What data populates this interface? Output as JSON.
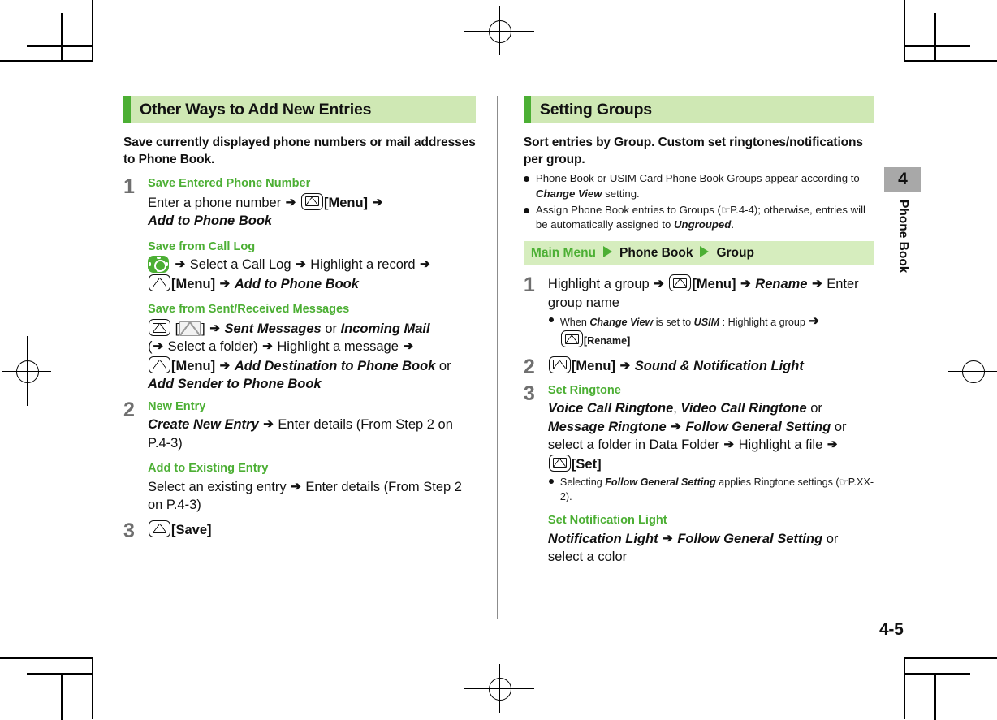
{
  "page": {
    "number": "4-5",
    "chapter_number": "4",
    "chapter_label": "Phone Book"
  },
  "left_column": {
    "section_title": "Other Ways to Add New Entries",
    "lead": "Save currently displayed phone numbers or mail addresses to Phone Book.",
    "steps": [
      {
        "number": "1",
        "sub_sections": [
          {
            "heading": "Save Entered Phone Number",
            "lines": [
              {
                "parts": [
                  {
                    "t": "text",
                    "v": "Enter a phone number "
                  },
                  {
                    "t": "arrow"
                  },
                  {
                    "t": "text",
                    "v": " "
                  },
                  {
                    "t": "key-env"
                  },
                  {
                    "t": "bold",
                    "v": "[Menu]"
                  },
                  {
                    "t": "text",
                    "v": " "
                  },
                  {
                    "t": "arrow"
                  }
                ]
              },
              {
                "parts": [
                  {
                    "t": "bolditalic",
                    "v": "Add to Phone Book"
                  }
                ]
              }
            ]
          },
          {
            "heading": "Save from Call Log",
            "lines": [
              {
                "parts": [
                  {
                    "t": "key-nav"
                  },
                  {
                    "t": "text",
                    "v": " "
                  },
                  {
                    "t": "arrow"
                  },
                  {
                    "t": "text",
                    "v": " Select a Call Log "
                  },
                  {
                    "t": "arrow"
                  },
                  {
                    "t": "text",
                    "v": " Highlight a record "
                  },
                  {
                    "t": "arrow"
                  }
                ]
              },
              {
                "parts": [
                  {
                    "t": "key-env"
                  },
                  {
                    "t": "bold",
                    "v": "[Menu]"
                  },
                  {
                    "t": "text",
                    "v": " "
                  },
                  {
                    "t": "arrow"
                  },
                  {
                    "t": "text",
                    "v": " "
                  },
                  {
                    "t": "bolditalic",
                    "v": "Add to Phone Book"
                  }
                ]
              }
            ]
          },
          {
            "heading": "Save from Sent/Received Messages",
            "lines": [
              {
                "parts": [
                  {
                    "t": "key-env"
                  },
                  {
                    "t": "text",
                    "v": " ["
                  },
                  {
                    "t": "disp-env"
                  },
                  {
                    "t": "text",
                    "v": "] "
                  },
                  {
                    "t": "arrow"
                  },
                  {
                    "t": "text",
                    "v": " "
                  },
                  {
                    "t": "bolditalic",
                    "v": "Sent Messages"
                  },
                  {
                    "t": "text",
                    "v": " or "
                  },
                  {
                    "t": "bolditalic",
                    "v": "Incoming Mail"
                  }
                ]
              },
              {
                "parts": [
                  {
                    "t": "text",
                    "v": "("
                  },
                  {
                    "t": "arrow"
                  },
                  {
                    "t": "text",
                    "v": " Select a folder) "
                  },
                  {
                    "t": "arrow"
                  },
                  {
                    "t": "text",
                    "v": " Highlight a message "
                  },
                  {
                    "t": "arrow"
                  }
                ]
              },
              {
                "parts": [
                  {
                    "t": "key-env"
                  },
                  {
                    "t": "bold",
                    "v": "[Menu]"
                  },
                  {
                    "t": "text",
                    "v": " "
                  },
                  {
                    "t": "arrow"
                  },
                  {
                    "t": "text",
                    "v": " "
                  },
                  {
                    "t": "bolditalic",
                    "v": "Add Destination to Phone Book"
                  },
                  {
                    "t": "text",
                    "v": " or"
                  }
                ]
              },
              {
                "parts": [
                  {
                    "t": "bolditalic",
                    "v": "Add Sender to Phone Book"
                  }
                ]
              }
            ]
          }
        ]
      },
      {
        "number": "2",
        "sub_sections": [
          {
            "heading": "New Entry",
            "lines": [
              {
                "parts": [
                  {
                    "t": "bolditalic",
                    "v": "Create New Entry"
                  },
                  {
                    "t": "text",
                    "v": " "
                  },
                  {
                    "t": "arrow"
                  },
                  {
                    "t": "text",
                    "v": " Enter details (From Step 2 on P.4-3)"
                  }
                ]
              }
            ]
          },
          {
            "heading": "Add to Existing Entry",
            "lines": [
              {
                "parts": [
                  {
                    "t": "text",
                    "v": "Select an existing entry "
                  },
                  {
                    "t": "arrow"
                  },
                  {
                    "t": "text",
                    "v": " Enter details (From Step 2 on P.4-3)"
                  }
                ]
              }
            ]
          }
        ]
      },
      {
        "number": "3",
        "sub_sections": [
          {
            "heading": "",
            "lines": [
              {
                "parts": [
                  {
                    "t": "key-env"
                  },
                  {
                    "t": "bold",
                    "v": "[Save]"
                  }
                ]
              }
            ]
          }
        ]
      }
    ]
  },
  "right_column": {
    "section_title": "Setting Groups",
    "lead": "Sort entries by Group. Custom set ringtones/notifications per group.",
    "bullets": [
      {
        "parts": [
          {
            "t": "text",
            "v": "Phone Book or USIM Card Phone Book Groups appear according to "
          },
          {
            "t": "bolditalic",
            "v": "Change View"
          },
          {
            "t": "text",
            "v": " setting."
          }
        ]
      },
      {
        "parts": [
          {
            "t": "text",
            "v": "Assign Phone Book entries to Groups ("
          },
          {
            "t": "ref-hand"
          },
          {
            "t": "text",
            "v": "P.4-4); otherwise, entries will be automatically assigned to "
          },
          {
            "t": "bolditalic",
            "v": "Ungrouped"
          },
          {
            "t": "text",
            "v": "."
          }
        ]
      }
    ],
    "menu_path": {
      "root": "Main Menu",
      "items": [
        "Phone Book",
        "Group"
      ]
    },
    "steps": [
      {
        "number": "1",
        "sub_sections": [
          {
            "heading": "",
            "lines": [
              {
                "parts": [
                  {
                    "t": "text",
                    "v": "Highlight a group "
                  },
                  {
                    "t": "arrow"
                  },
                  {
                    "t": "text",
                    "v": " "
                  },
                  {
                    "t": "key-env"
                  },
                  {
                    "t": "bold",
                    "v": "[Menu]"
                  },
                  {
                    "t": "text",
                    "v": " "
                  },
                  {
                    "t": "arrow"
                  },
                  {
                    "t": "text",
                    "v": " "
                  },
                  {
                    "t": "bolditalic",
                    "v": "Rename"
                  },
                  {
                    "t": "text",
                    "v": " "
                  },
                  {
                    "t": "arrow"
                  },
                  {
                    "t": "text",
                    "v": " Enter group name"
                  }
                ]
              }
            ],
            "sub_bullets": [
              {
                "parts": [
                  {
                    "t": "text",
                    "v": "When "
                  },
                  {
                    "t": "bolditalic",
                    "v": "Change View"
                  },
                  {
                    "t": "text",
                    "v": " is set to "
                  },
                  {
                    "t": "bolditalic",
                    "v": "USIM"
                  },
                  {
                    "t": "text",
                    "v": " : Highlight a group "
                  },
                  {
                    "t": "arrow"
                  },
                  {
                    "t": "br"
                  },
                  {
                    "t": "key-env"
                  },
                  {
                    "t": "bold",
                    "v": "[Rename]"
                  }
                ]
              }
            ]
          }
        ]
      },
      {
        "number": "2",
        "sub_sections": [
          {
            "heading": "",
            "lines": [
              {
                "parts": [
                  {
                    "t": "key-env"
                  },
                  {
                    "t": "bold",
                    "v": "[Menu]"
                  },
                  {
                    "t": "text",
                    "v": " "
                  },
                  {
                    "t": "arrow"
                  },
                  {
                    "t": "text",
                    "v": " "
                  },
                  {
                    "t": "bolditalic",
                    "v": "Sound & Notification Light"
                  }
                ]
              }
            ]
          }
        ]
      },
      {
        "number": "3",
        "sub_sections": [
          {
            "heading": "Set Ringtone",
            "lines": [
              {
                "parts": [
                  {
                    "t": "bolditalic",
                    "v": "Voice Call Ringtone"
                  },
                  {
                    "t": "text",
                    "v": ", "
                  },
                  {
                    "t": "bolditalic",
                    "v": "Video Call Ringtone"
                  },
                  {
                    "t": "text",
                    "v": " or "
                  },
                  {
                    "t": "bolditalic",
                    "v": "Message Ringtone"
                  },
                  {
                    "t": "text",
                    "v": " "
                  },
                  {
                    "t": "arrow"
                  },
                  {
                    "t": "text",
                    "v": " "
                  },
                  {
                    "t": "bolditalic",
                    "v": "Follow General Setting"
                  },
                  {
                    "t": "text",
                    "v": " or select a folder in Data Folder "
                  },
                  {
                    "t": "arrow"
                  },
                  {
                    "t": "text",
                    "v": " Highlight a file "
                  },
                  {
                    "t": "arrow"
                  }
                ]
              },
              {
                "parts": [
                  {
                    "t": "key-env"
                  },
                  {
                    "t": "bold",
                    "v": "[Set]"
                  }
                ]
              }
            ],
            "sub_bullets": [
              {
                "parts": [
                  {
                    "t": "text",
                    "v": "Selecting "
                  },
                  {
                    "t": "bolditalic",
                    "v": "Follow General Setting"
                  },
                  {
                    "t": "text",
                    "v": " applies Ringtone settings ("
                  },
                  {
                    "t": "ref-hand"
                  },
                  {
                    "t": "text",
                    "v": "P.XX-2)."
                  }
                ]
              }
            ]
          },
          {
            "heading": "Set Notification Light",
            "lines": [
              {
                "parts": [
                  {
                    "t": "bolditalic",
                    "v": "Notification Light"
                  },
                  {
                    "t": "text",
                    "v": " "
                  },
                  {
                    "t": "arrow"
                  },
                  {
                    "t": "text",
                    "v": " "
                  },
                  {
                    "t": "bolditalic",
                    "v": "Follow General Setting"
                  },
                  {
                    "t": "text",
                    "v": " or select a color"
                  }
                ]
              }
            ]
          }
        ]
      }
    ]
  },
  "colors": {
    "accent_green": "#4caf34",
    "header_band": "#cfe8b4",
    "menu_band": "#d6edbe",
    "step_number": "#6f6f6f",
    "tab_gray": "#a8a8a8"
  }
}
